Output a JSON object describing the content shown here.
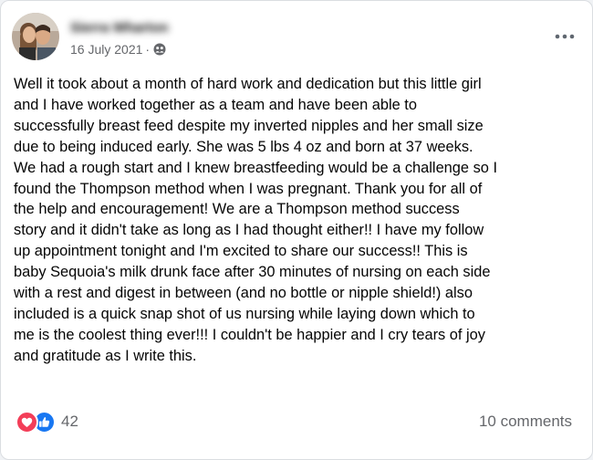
{
  "post": {
    "author": "Sierra Wharton",
    "date": "16 July 2021",
    "separator": "·",
    "audience_icon": "friends-icon",
    "text": "Well it took about a month of hard work and dedication but this little girl\nand I have worked together as a team and have been able to\nsuccessfully breast feed despite my inverted nipples and her small size\ndue to being induced early. She was 5 lbs 4 oz and born at 37 weeks.\nWe had a rough start and I knew breastfeeding would be a challenge so I\nfound the Thompson method when I was pregnant. Thank you for all of\nthe help and encouragement! We are a Thompson method success\nstory and it didn't take as long as I had thought either!! I have my follow\nup appointment tonight and I'm excited to share our success!! This is\nbaby Sequoia's milk drunk face after 30 minutes of nursing on each side\nwith a rest and digest in between (and no bottle or nipple shield!) also\nincluded is a quick snap shot of us nursing while laying down which to\nme is the coolest thing ever!!! I couldn't be happier and I cry tears of joy\nand gratitude as I write this."
  },
  "footer": {
    "reaction_icons": [
      "heart-icon",
      "thumbs-up-icon"
    ],
    "reaction_count": "42",
    "comments": "10 comments"
  },
  "colors": {
    "love": "#f33e58",
    "like": "#1877f2",
    "secondary_text": "#65676b",
    "primary_text": "#050505"
  }
}
